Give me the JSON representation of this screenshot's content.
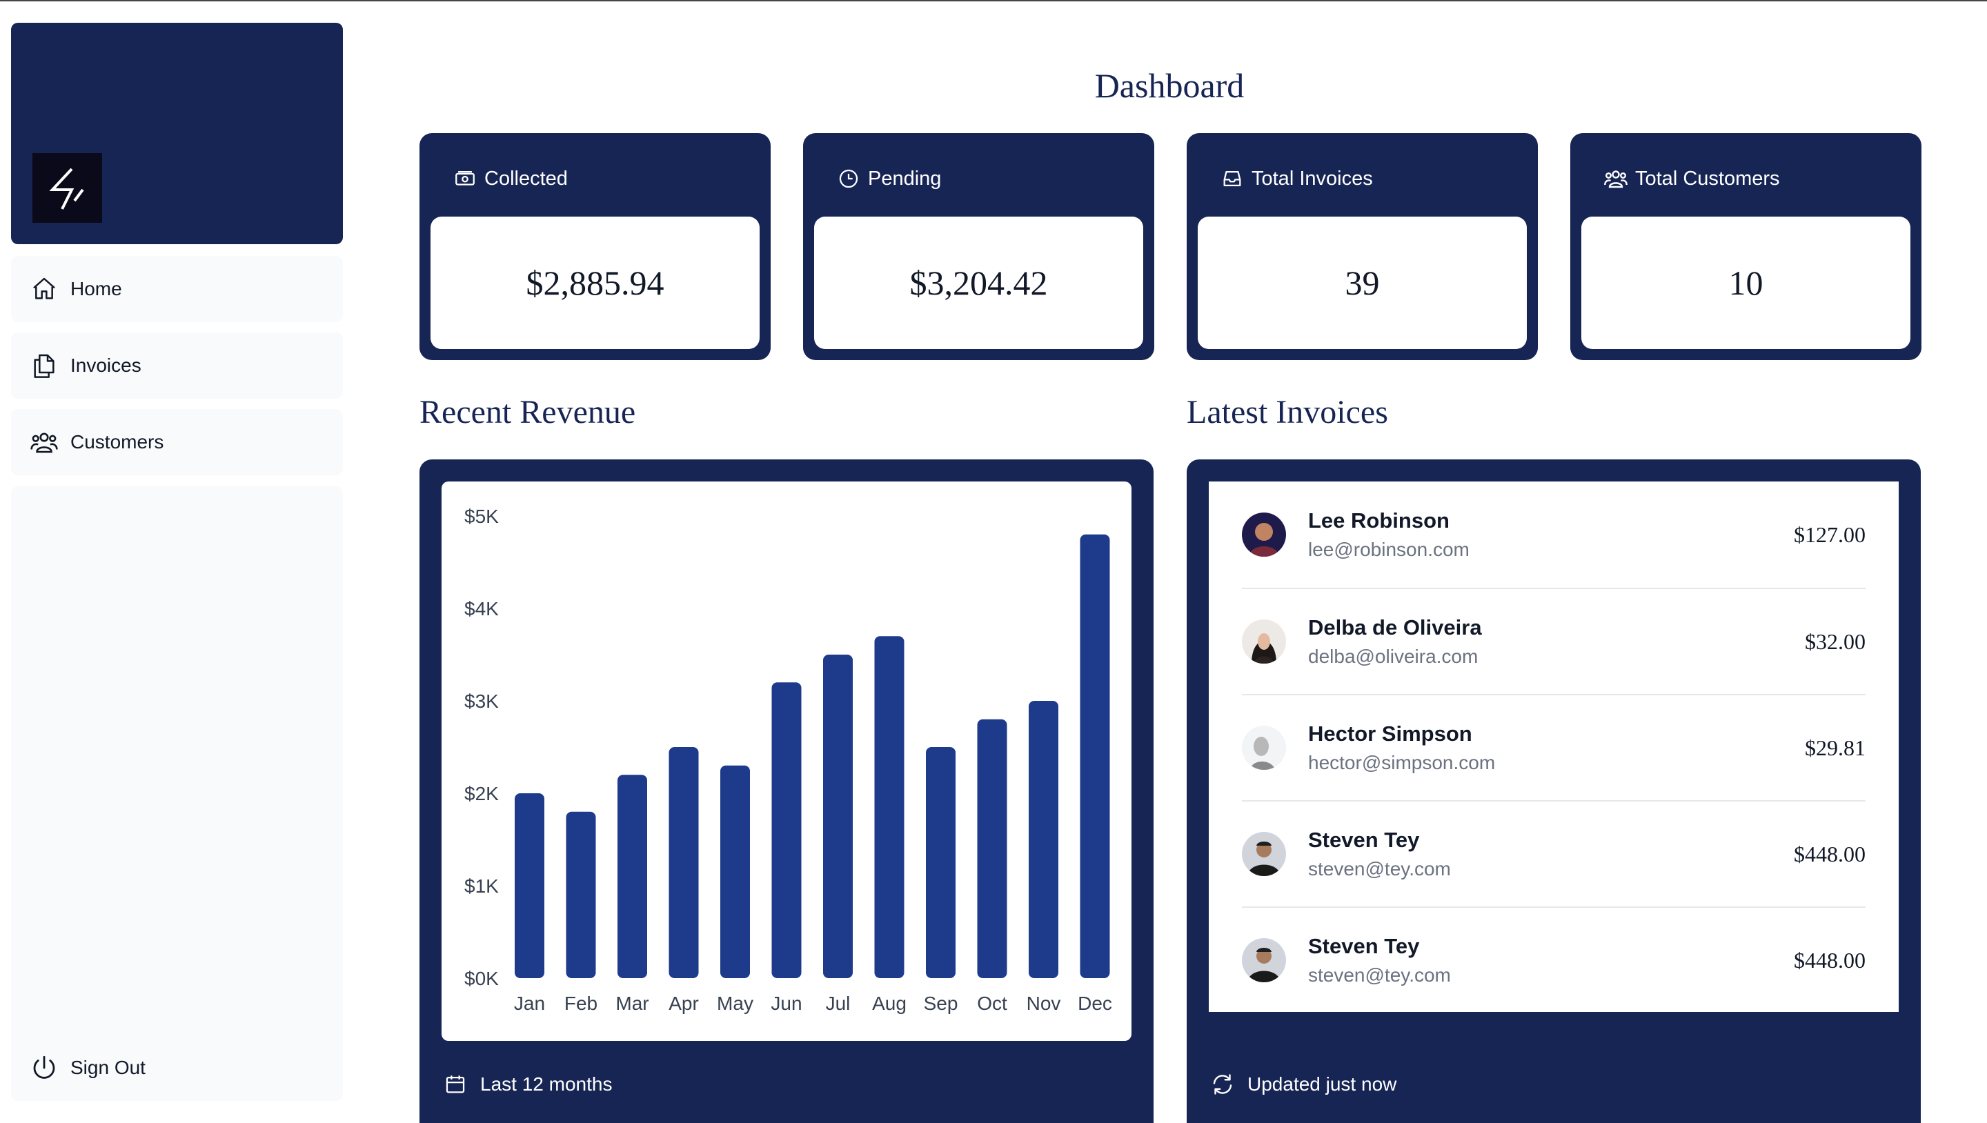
{
  "sidebar": {
    "logo_icon": "lightning-bolt-icon",
    "nav": [
      {
        "label": "Home",
        "icon": "home-icon"
      },
      {
        "label": "Invoices",
        "icon": "documents-icon"
      },
      {
        "label": "Customers",
        "icon": "users-icon"
      }
    ],
    "signout": {
      "label": "Sign Out",
      "icon": "power-icon"
    }
  },
  "header": {
    "title": "Dashboard"
  },
  "cards": [
    {
      "label": "Collected",
      "value": "$2,885.94",
      "icon": "banknotes-icon"
    },
    {
      "label": "Pending",
      "value": "$3,204.42",
      "icon": "clock-icon"
    },
    {
      "label": "Total Invoices",
      "value": "39",
      "icon": "inbox-icon"
    },
    {
      "label": "Total Customers",
      "value": "10",
      "icon": "user-group-icon"
    }
  ],
  "revenue": {
    "title": "Recent Revenue",
    "footer": "Last 12 months",
    "footer_icon": "calendar-icon"
  },
  "invoices": {
    "title": "Latest Invoices",
    "footer": "Updated just now",
    "footer_icon": "refresh-icon",
    "rows": [
      {
        "name": "Lee Robinson",
        "email": "lee@robinson.com",
        "amount": "$127.00"
      },
      {
        "name": "Delba de Oliveira",
        "email": "delba@oliveira.com",
        "amount": "$32.00"
      },
      {
        "name": "Hector Simpson",
        "email": "hector@simpson.com",
        "amount": "$29.81"
      },
      {
        "name": "Steven Tey",
        "email": "steven@tey.com",
        "amount": "$448.00"
      },
      {
        "name": "Steven Tey",
        "email": "steven@tey.com",
        "amount": "$448.00"
      }
    ]
  },
  "colors": {
    "brand": "#172554",
    "bar": "#1e3a8a",
    "nav_bg": "#f9fafb"
  },
  "chart_data": {
    "type": "bar",
    "categories": [
      "Jan",
      "Feb",
      "Mar",
      "Apr",
      "May",
      "Jun",
      "Jul",
      "Aug",
      "Sep",
      "Oct",
      "Nov",
      "Dec"
    ],
    "values": [
      2000,
      1800,
      2200,
      2500,
      2300,
      3200,
      3500,
      3700,
      2500,
      2800,
      3000,
      4800
    ],
    "ylim": [
      0,
      5000
    ],
    "yticks": [
      "$0K",
      "$1K",
      "$2K",
      "$3K",
      "$4K",
      "$5K"
    ],
    "grid": false
  }
}
